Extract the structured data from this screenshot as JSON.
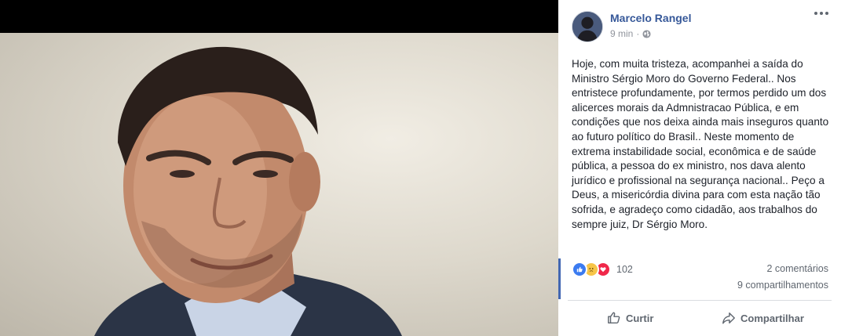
{
  "media": {
    "photo_alt_icon": "portrait-photo"
  },
  "post": {
    "author": "Marcelo Rangel",
    "time": "9 min",
    "separator": "·",
    "privacy_icon": "globe-icon",
    "text": "Hoje, com muita tristeza, acompanhei a saída do Ministro Sérgio Moro do Governo Federal.. Nos entristece profundamente, por termos perdido um dos alicerces morais da Admnistracao Pública, e em condições que nos deixa ainda mais inseguros quanto ao futuro político do Brasil.. Neste momento de extrema instabilidade social, econômica e de saúde pública, a pessoa do ex ministro, nos dava alento jurídico e profissional na segurança nacional.. Peço a Deus, a misericórdia divina para com esta nação tão sofrida, e agradeço como cidadão, aos trabalhos do sempre juiz, Dr Sérgio Moro."
  },
  "stats": {
    "reactions_count": "102",
    "comments": "2 comentários",
    "shares": "9 compartilhamentos",
    "reaction_icons": [
      "like-icon",
      "sad-icon",
      "love-icon"
    ]
  },
  "actions": {
    "like_label": "Curtir",
    "share_label": "Compartilhar"
  },
  "colors": {
    "author_link": "#365899",
    "meta_gray": "#90949c",
    "like_blue": "#3b7bf0",
    "love_red": "#f0284a",
    "sad_yellow": "#f7c548",
    "accent_bar": "#4267b2"
  }
}
